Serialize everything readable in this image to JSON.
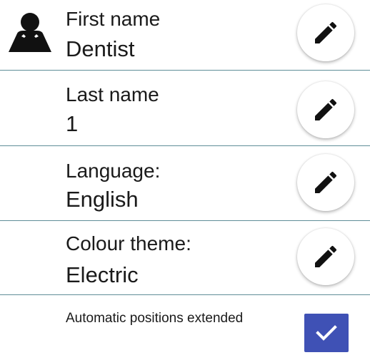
{
  "profile": {
    "fields": [
      {
        "label": "First name",
        "value": "Dentist",
        "icon": "pencil-icon"
      },
      {
        "label": "Last name",
        "value": "1",
        "icon": "pencil-icon"
      },
      {
        "label": "Language:",
        "value": "English",
        "icon": "pencil-icon"
      },
      {
        "label": "Colour theme:",
        "value": "Electric",
        "icon": "pencil-icon"
      }
    ],
    "avatar_icon": "user-icon",
    "automatic_positions": {
      "label": "Automatic positions extended",
      "checked": true
    }
  },
  "colors": {
    "divider": "#5f8e98",
    "checkbox_accent": "#3f51b5",
    "text": "#1a1a1a"
  }
}
